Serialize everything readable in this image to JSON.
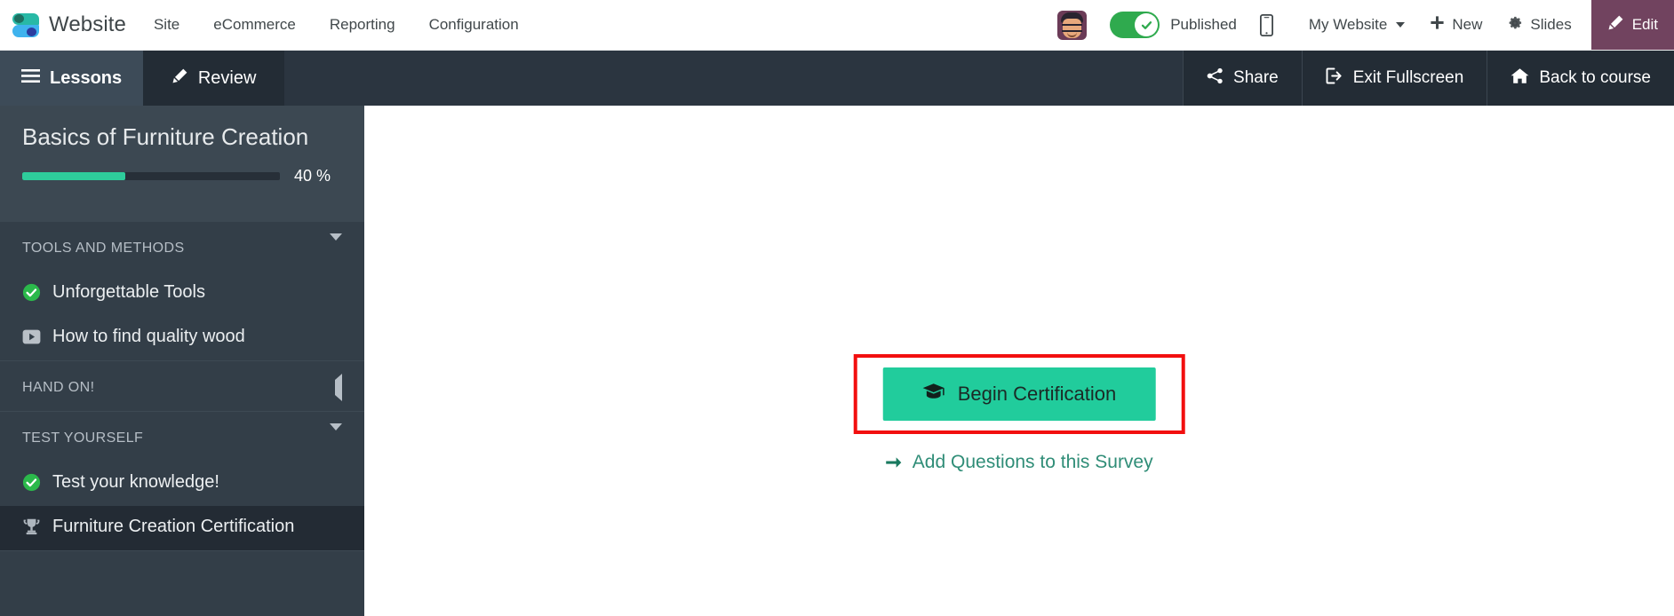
{
  "topbar": {
    "brand": "Website",
    "logo_icon": "odoo-website-logo",
    "menu": [
      "Site",
      "eCommerce",
      "Reporting",
      "Configuration"
    ],
    "avatar_icon": "user-avatar",
    "publish": {
      "label": "Published",
      "state": "on",
      "check_icon": "check-circle-icon",
      "color": "#2faa4e"
    },
    "mobile_preview_icon": "mobile-phone-icon",
    "site_selector": {
      "label": "My Website",
      "caret_icon": "chevron-down-icon"
    },
    "new_button": {
      "label": "New",
      "icon": "plus-icon"
    },
    "slides_button": {
      "label": "Slides",
      "icon": "gear-icon"
    },
    "edit_button": {
      "label": "Edit",
      "icon": "pencil-icon",
      "color": "#71435f"
    }
  },
  "subbar": {
    "tabs": [
      {
        "label": "Lessons",
        "icon": "hamburger-icon",
        "active": true
      },
      {
        "label": "Review",
        "icon": "pencil-icon",
        "active": false
      }
    ],
    "actions": [
      {
        "label": "Share",
        "icon": "share-icon"
      },
      {
        "label": "Exit Fullscreen",
        "icon": "exit-icon"
      },
      {
        "label": "Back to course",
        "icon": "home-icon"
      }
    ]
  },
  "sidebar": {
    "course_title": "Basics of Furniture Creation",
    "progress": {
      "percent_label": "40 %",
      "percent_value": 40,
      "fill_color": "#2ecc9b"
    },
    "sections": [
      {
        "title": "TOOLS AND METHODS",
        "caret_icon": "chevron-down-icon",
        "expanded": true,
        "items": [
          {
            "label": "Unforgettable Tools",
            "icon": "check-circle-icon",
            "active": false
          },
          {
            "label": "How to find quality wood",
            "icon": "video-play-icon",
            "active": false
          }
        ]
      },
      {
        "title": "HAND ON!",
        "caret_icon": "chevron-left-icon",
        "expanded": false,
        "items": []
      },
      {
        "title": "TEST YOURSELF",
        "caret_icon": "chevron-down-icon",
        "expanded": true,
        "items": [
          {
            "label": "Test your knowledge!",
            "icon": "check-circle-icon",
            "active": false
          },
          {
            "label": "Furniture Creation Certification",
            "icon": "trophy-icon",
            "active": true
          }
        ]
      }
    ]
  },
  "main": {
    "begin_button": {
      "label": "Begin Certification",
      "icon": "graduation-cap-icon",
      "color": "#21cc9c"
    },
    "highlight_color": "#f20f0f",
    "add_questions_link": {
      "label": "Add Questions to this Survey",
      "icon": "arrow-right-icon",
      "color": "#2f8d77"
    }
  }
}
